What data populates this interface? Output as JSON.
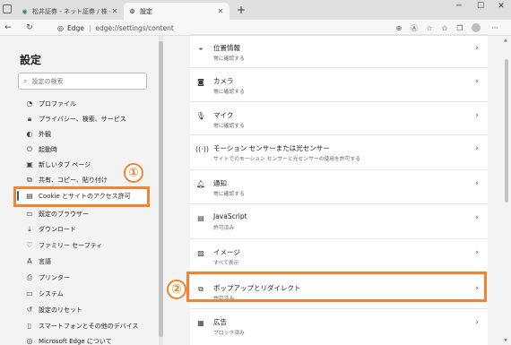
{
  "tabs": [
    {
      "title": "松井証券 - ネット証券 / 株・投信",
      "icon": "brand-icon"
    },
    {
      "title": "設定",
      "icon": "gear-icon"
    }
  ],
  "new_tab_label": "+",
  "address": {
    "site_label": "Edge",
    "separator": "|",
    "url": "edge://settings/content"
  },
  "sidebar": {
    "title": "設定",
    "search_placeholder": "設定の検索",
    "items": [
      {
        "label": "プロファイル",
        "icon": "profile-icon"
      },
      {
        "label": "プライバシー、検索、サービス",
        "icon": "lock-icon"
      },
      {
        "label": "外観",
        "icon": "appearance-icon"
      },
      {
        "label": "起動時",
        "icon": "power-icon"
      },
      {
        "label": "新しいタブ ページ",
        "icon": "newtab-icon"
      },
      {
        "label": "共有、コピー、貼り付け",
        "icon": "share-icon"
      },
      {
        "label": "Cookie とサイトのアクセス許可",
        "icon": "cookie-icon",
        "active": true
      },
      {
        "label": "既定のブラウザー",
        "icon": "browser-icon"
      },
      {
        "label": "ダウンロード",
        "icon": "download-icon"
      },
      {
        "label": "ファミリー セーフティ",
        "icon": "family-icon"
      },
      {
        "label": "言語",
        "icon": "language-icon"
      },
      {
        "label": "プリンター",
        "icon": "printer-icon"
      },
      {
        "label": "システム",
        "icon": "system-icon"
      },
      {
        "label": "設定のリセット",
        "icon": "reset-icon"
      },
      {
        "label": "スマートフォンとその他のデバイス",
        "icon": "phone-icon"
      },
      {
        "label": "Microsoft Edge について",
        "icon": "edge-icon"
      }
    ]
  },
  "content": {
    "rows": [
      {
        "label": "位置情報",
        "sub": "常に確認する",
        "icon": "location-icon"
      },
      {
        "label": "カメラ",
        "sub": "常に確認する",
        "icon": "camera-icon"
      },
      {
        "label": "マイク",
        "sub": "常に確認する",
        "icon": "microphone-icon"
      },
      {
        "label": "モーション センサーまたは光センサー",
        "sub": "サイトでのモーション センサーと光センサーの使用を許可する",
        "icon": "sensor-icon"
      },
      {
        "label": "通知",
        "sub": "常に確認する",
        "icon": "bell-icon"
      },
      {
        "label": "JavaScript",
        "sub": "許可済み",
        "icon": "code-icon"
      },
      {
        "label": "イメージ",
        "sub": "すべて表示",
        "icon": "image-icon"
      },
      {
        "label": "ポップアップとリダイレクト",
        "sub": "許可済み",
        "icon": "popup-icon"
      },
      {
        "label": "広告",
        "sub": "ブロック済み",
        "icon": "ads-icon"
      }
    ]
  },
  "annotations": {
    "badge_1": "①",
    "badge_2": "②"
  },
  "colors": {
    "highlight": "#ef8433",
    "active_bar": "#1a5fb4"
  }
}
